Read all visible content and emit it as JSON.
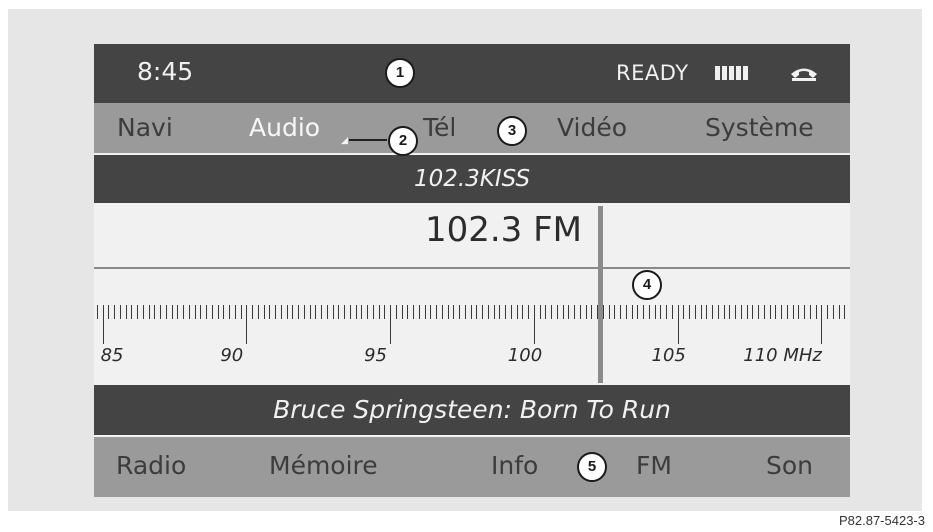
{
  "status": {
    "time": "8:45",
    "ready": "READY"
  },
  "menu": [
    {
      "label": "Navi",
      "active": false
    },
    {
      "label": "Audio",
      "active": true
    },
    {
      "label": "Tél",
      "active": false
    },
    {
      "label": "Vidéo",
      "active": false
    },
    {
      "label": "Système",
      "active": false
    }
  ],
  "station": {
    "name": "102.3KISS"
  },
  "tuner": {
    "frequency": "102.3 FM",
    "frequency_value": 102.3,
    "scale_min": 84.7,
    "scale_max": 111.0,
    "scale_labels": [
      "85",
      "90",
      "95",
      "100",
      "105",
      "110 MHz"
    ]
  },
  "track": {
    "text": "Bruce Springsteen: Born To Run"
  },
  "softkeys": [
    {
      "label": "Radio"
    },
    {
      "label": "Mémoire"
    },
    {
      "label": "Info"
    },
    {
      "label": "FM"
    },
    {
      "label": "Son"
    }
  ],
  "callouts": [
    "1",
    "2",
    "3",
    "4",
    "5"
  ],
  "reference": "P82.87-5423-3",
  "icons": {
    "signal": "signal-strength-icon",
    "phone": "phone-handset-icon"
  },
  "colors": {
    "dark_bar": "#444444",
    "menu_bar": "#9a9a9a",
    "display_bg": "#f1f1f1"
  }
}
